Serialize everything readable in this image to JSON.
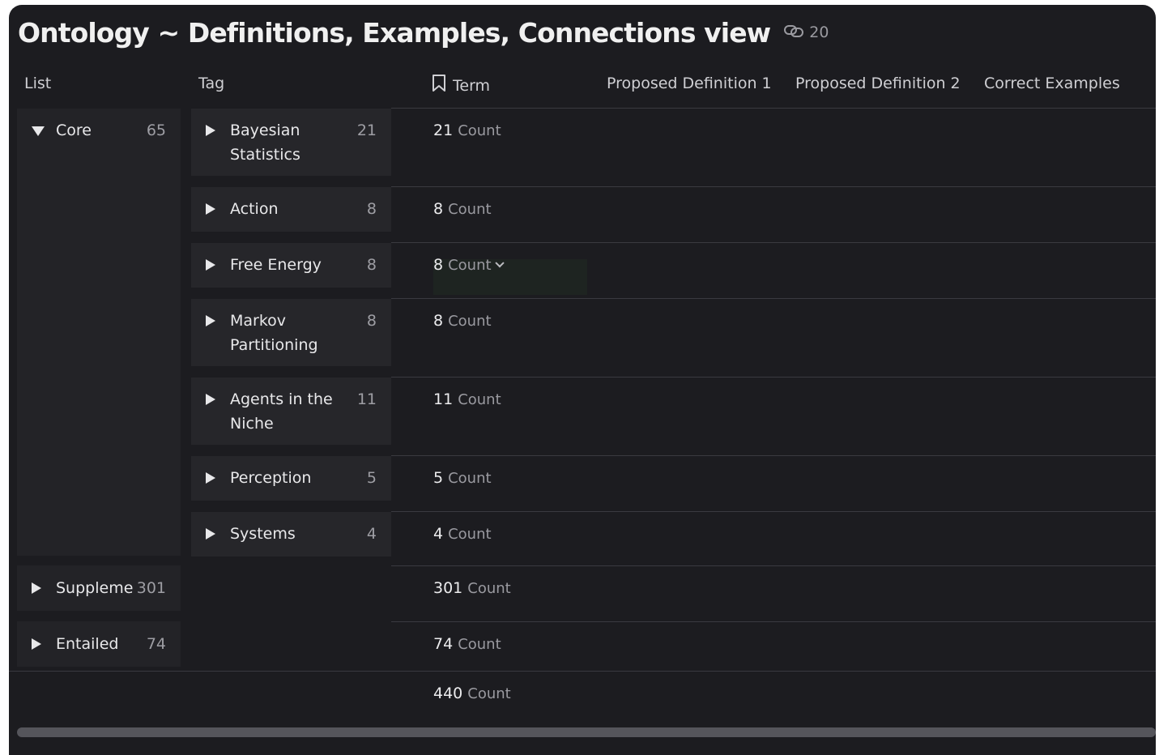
{
  "header": {
    "title": "Ontology ~ Definitions, Examples, Connections view",
    "link_count": "20"
  },
  "columns": {
    "list": "List",
    "tag": "Tag",
    "term": "Term",
    "def1": "Proposed Definition 1",
    "def2": "Proposed Definition 2",
    "examples": "Correct Examples"
  },
  "lists": [
    {
      "label": "Core",
      "count": "65",
      "expanded": true
    },
    {
      "label": "Suppleme",
      "count": "301",
      "expanded": false
    },
    {
      "label": "Entailed",
      "count": "74",
      "expanded": false
    }
  ],
  "tags": [
    {
      "label_lines": [
        "Bayesian",
        "Statistics"
      ],
      "count": "21"
    },
    {
      "label_lines": [
        "Action"
      ],
      "count": "8"
    },
    {
      "label_lines": [
        "Free Energy"
      ],
      "count": "8"
    },
    {
      "label_lines": [
        "Markov",
        "Partitioning"
      ],
      "count": "8"
    },
    {
      "label_lines": [
        "Agents in the",
        "Niche"
      ],
      "count": "11"
    },
    {
      "label_lines": [
        "Perception"
      ],
      "count": "5"
    },
    {
      "label_lines": [
        "Systems"
      ],
      "count": "4"
    }
  ],
  "term_counts": [
    {
      "value": "21",
      "label": "Count"
    },
    {
      "value": "8",
      "label": "Count"
    },
    {
      "value": "8",
      "label": "Count"
    },
    {
      "value": "8",
      "label": "Count"
    },
    {
      "value": "11",
      "label": "Count"
    },
    {
      "value": "5",
      "label": "Count"
    },
    {
      "value": "4",
      "label": "Count"
    },
    {
      "value": "301",
      "label": "Count"
    },
    {
      "value": "74",
      "label": "Count"
    }
  ],
  "total": {
    "value": "440",
    "label": "Count"
  },
  "icons": {
    "link": "link-icon",
    "bookmark": "bookmark-icon",
    "expand": "triangle-right-icon",
    "collapse": "triangle-down-icon"
  }
}
